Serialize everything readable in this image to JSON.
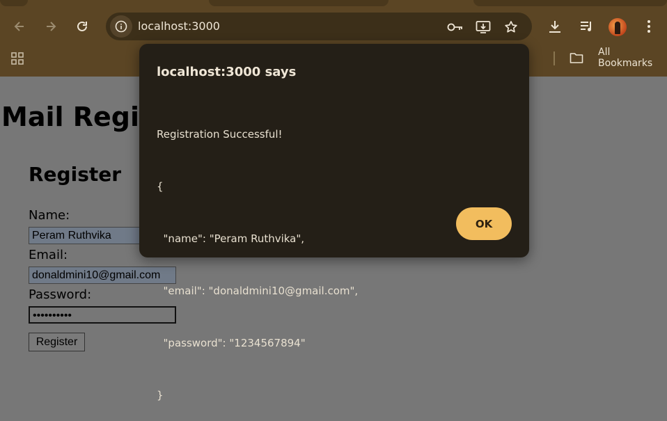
{
  "browser": {
    "url": "localhost:3000",
    "bookmarks_label": "All Bookmarks",
    "colors": {
      "chrome": "#5b4524",
      "omnibox": "#3c2f19"
    }
  },
  "page": {
    "title": "Mail Regist",
    "form_heading": "Register",
    "name_label": "Name:",
    "name_value": "Peram Ruthvika",
    "email_label": "Email:",
    "email_value": "donaldmini10@gmail.com",
    "password_label": "Password:",
    "password_value": "••••••••••",
    "submit_label": "Register"
  },
  "dialog": {
    "title": "localhost:3000 says",
    "message_lines": [
      "Registration Successful!",
      "{",
      "  \"name\": \"Peram Ruthvika\",",
      "  \"email\": \"donaldmini10@gmail.com\",",
      "  \"password\": \"1234567894\"",
      "}"
    ],
    "ok_label": "OK",
    "colors": {
      "background": "#241f17",
      "button": "#f2bd5e"
    }
  }
}
